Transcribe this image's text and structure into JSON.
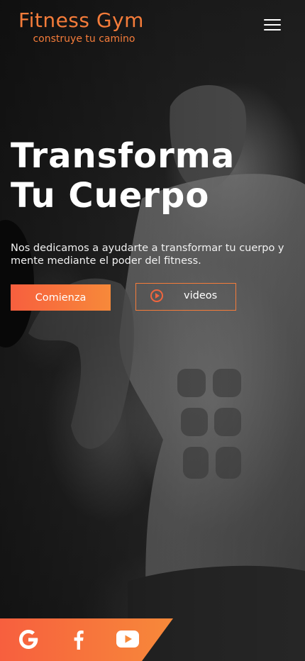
{
  "header": {
    "brand_title": "Fitness Gym",
    "brand_tagline": "construye tu camino",
    "menu_icon": "hamburger-menu-icon"
  },
  "hero": {
    "title_line1": "Transforma",
    "title_line2": "Tu Cuerpo",
    "description": "Nos dedicamos a ayudarte a transformar tu cuerpo y mente mediante el poder del fitness.",
    "start_button_label": "Comienza",
    "videos_button_label": "videos",
    "videos_icon": "play-circle-icon"
  },
  "social": {
    "items": [
      {
        "icon": "google-icon"
      },
      {
        "icon": "facebook-icon"
      },
      {
        "icon": "youtube-icon"
      }
    ]
  },
  "colors": {
    "accent_orange": "#f57c3a",
    "gradient_start": "#f75f3e",
    "gradient_end": "#f7893a",
    "text_white": "#ffffff"
  }
}
